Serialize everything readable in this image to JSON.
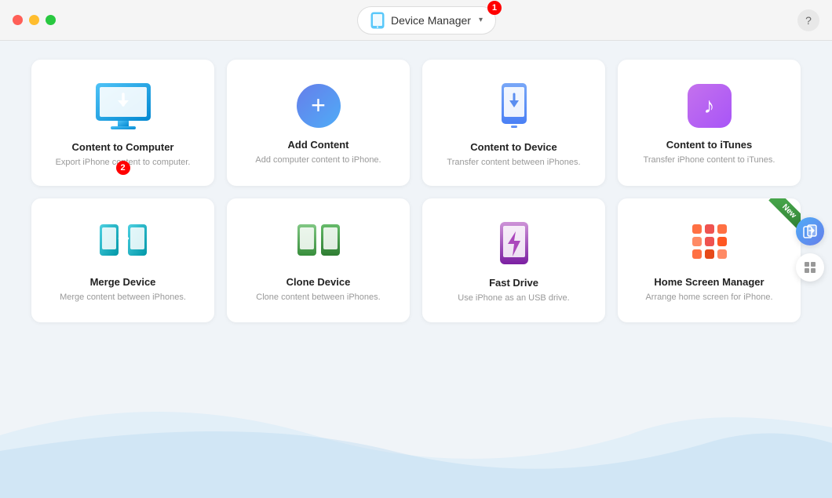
{
  "titlebar": {
    "app_name": "Device Manager",
    "chevron": "▾",
    "help": "?",
    "badge": "1",
    "badge2": "2"
  },
  "cards": [
    {
      "id": "content-to-computer",
      "title": "Content to Computer",
      "desc": "Export iPhone content to computer.",
      "badge": "2"
    },
    {
      "id": "add-content",
      "title": "Add Content",
      "desc": "Add computer content to iPhone."
    },
    {
      "id": "content-to-device",
      "title": "Content to Device",
      "desc": "Transfer content between iPhones."
    },
    {
      "id": "content-to-itunes",
      "title": "Content to iTunes",
      "desc": "Transfer iPhone content to iTunes."
    },
    {
      "id": "merge-device",
      "title": "Merge Device",
      "desc": "Merge content between iPhones."
    },
    {
      "id": "clone-device",
      "title": "Clone Device",
      "desc": "Clone content between iPhones."
    },
    {
      "id": "fast-drive",
      "title": "Fast Drive",
      "desc": "Use iPhone as an USB drive."
    },
    {
      "id": "home-screen-manager",
      "title": "Home Screen Manager",
      "desc": "Arrange home screen for iPhone.",
      "is_new": true
    }
  ],
  "sidebar": {
    "transfer_icon": "📦",
    "grid_icon": "⊞"
  }
}
